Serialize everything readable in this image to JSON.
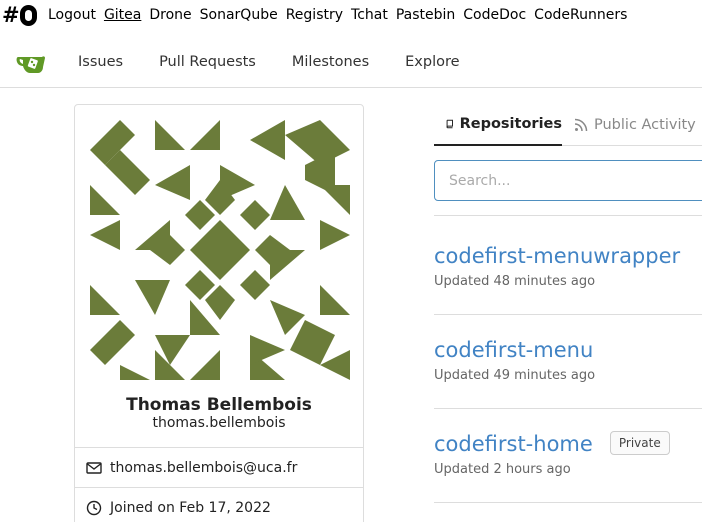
{
  "top_links": [
    "Logout",
    "Gitea",
    "Drone",
    "SonarQube",
    "Registry",
    "Tchat",
    "Pastebin",
    "CodeDoc",
    "CodeRunners"
  ],
  "top_active": "Gitea",
  "nav": {
    "items": [
      "Issues",
      "Pull Requests",
      "Milestones",
      "Explore"
    ]
  },
  "profile": {
    "full_name": "Thomas Bellembois",
    "username": "thomas.bellembois",
    "email": "thomas.bellembois@uca.fr",
    "joined": "Joined on Feb 17, 2022",
    "avatar_color": "#6b7c3a"
  },
  "tabs": {
    "repositories": "Repositories",
    "public_activity": "Public Activity"
  },
  "search": {
    "placeholder": "Search...",
    "value": ""
  },
  "repos": [
    {
      "name": "codefirst-menuwrapper",
      "updated": "Updated 48 minutes ago",
      "badge": ""
    },
    {
      "name": "codefirst-menu",
      "updated": "Updated 49 minutes ago",
      "badge": ""
    },
    {
      "name": "codefirst-home",
      "updated": "Updated 2 hours ago",
      "badge": "Private"
    }
  ],
  "colors": {
    "link": "#4183c4",
    "accent_border": "#4f8fbf",
    "gitea_green": "#609926"
  },
  "icons": [
    "logo-icon",
    "gitea-logo-icon",
    "mail-icon",
    "clock-icon",
    "repo-icon",
    "rss-icon"
  ]
}
